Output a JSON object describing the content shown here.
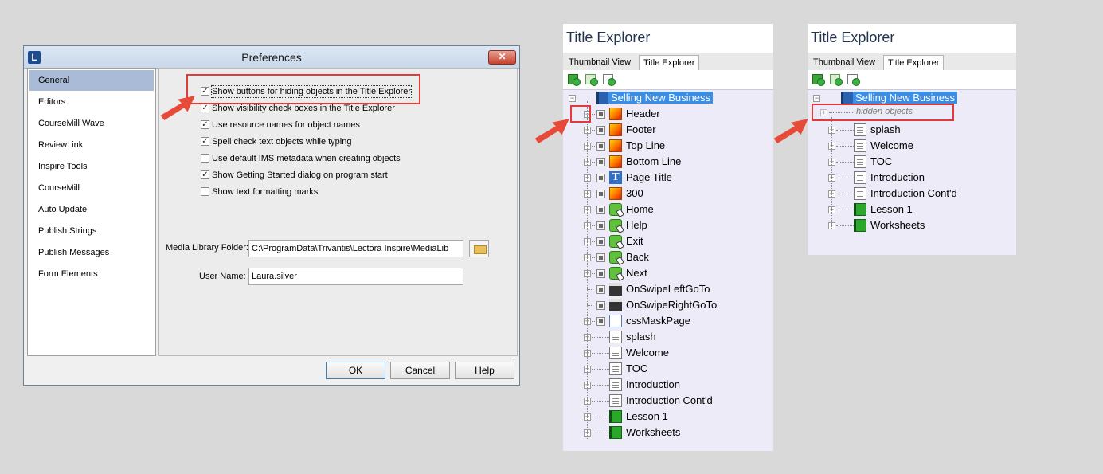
{
  "preferences": {
    "title": "Preferences",
    "app_icon": "L",
    "close_glyph": "✕",
    "sidebar": {
      "items": [
        "General",
        "Editors",
        "CourseMill Wave",
        "ReviewLink",
        "Inspire Tools",
        "CourseMill",
        "Auto Update",
        "Publish Strings",
        "Publish Messages",
        "Form Elements"
      ],
      "selected": "General"
    },
    "options": [
      {
        "label": "Show buttons for hiding objects in the Title Explorer",
        "checked": true
      },
      {
        "label": "Show visibility check boxes in the Title Explorer",
        "checked": true
      },
      {
        "label": "Use resource names for object names",
        "checked": true
      },
      {
        "label": "Spell check text objects while typing",
        "checked": true
      },
      {
        "label": "Use default IMS metadata when creating objects",
        "checked": false
      },
      {
        "label": "Show Getting Started dialog on program start",
        "checked": true
      },
      {
        "label": "Show text formatting marks",
        "checked": false
      }
    ],
    "media_library_label": "Media Library Folder:",
    "media_library_value": "C:\\ProgramData\\Trivantis\\Lectora Inspire\\MediaLib",
    "user_name_label": "User Name:",
    "user_name_value": "Laura.silver",
    "buttons": {
      "ok": "OK",
      "cancel": "Cancel",
      "help": "Help"
    }
  },
  "explorer_left": {
    "title": "Title Explorer",
    "tabs": [
      "Thumbnail View",
      "Title Explorer"
    ],
    "active_tab": "Title Explorer",
    "toolbar_icons": [
      "add-chapter-icon",
      "add-section-icon",
      "add-page-icon"
    ],
    "root": "Selling New Business",
    "items": [
      {
        "label": "Header",
        "icon": "image-icon"
      },
      {
        "label": "Footer",
        "icon": "image-icon"
      },
      {
        "label": "Top Line",
        "icon": "image-icon"
      },
      {
        "label": "Bottom Line",
        "icon": "image-icon"
      },
      {
        "label": "Page Title",
        "icon": "text-icon"
      },
      {
        "label": "300",
        "icon": "image-icon"
      },
      {
        "label": "Home",
        "icon": "button-icon"
      },
      {
        "label": "Help",
        "icon": "button-icon"
      },
      {
        "label": "Exit",
        "icon": "button-icon"
      },
      {
        "label": "Back",
        "icon": "button-icon"
      },
      {
        "label": "Next",
        "icon": "button-icon"
      },
      {
        "label": "OnSwipeLeftGoTo",
        "icon": "action-icon"
      },
      {
        "label": "OnSwipeRightGoTo",
        "icon": "action-icon"
      },
      {
        "label": "cssMaskPage",
        "icon": "css-page-icon"
      },
      {
        "label": "splash",
        "icon": "page-icon"
      },
      {
        "label": "Welcome",
        "icon": "page-icon"
      },
      {
        "label": "TOC",
        "icon": "page-icon"
      },
      {
        "label": "Introduction",
        "icon": "page-icon"
      },
      {
        "label": "Introduction Cont'd",
        "icon": "page-icon"
      },
      {
        "label": "Lesson 1",
        "icon": "chapter-icon"
      },
      {
        "label": "Worksheets",
        "icon": "chapter-icon"
      }
    ]
  },
  "explorer_right": {
    "title": "Title Explorer",
    "tabs": [
      "Thumbnail View",
      "Title Explorer"
    ],
    "active_tab": "Title Explorer",
    "toolbar_icons": [
      "add-chapter-icon",
      "add-section-icon",
      "add-page-icon"
    ],
    "root": "Selling New Business",
    "hidden_label": "hidden objects",
    "items": [
      {
        "label": "splash",
        "icon": "page-icon"
      },
      {
        "label": "Welcome",
        "icon": "page-icon"
      },
      {
        "label": "TOC",
        "icon": "page-icon"
      },
      {
        "label": "Introduction",
        "icon": "page-icon"
      },
      {
        "label": "Introduction Cont'd",
        "icon": "page-icon"
      },
      {
        "label": "Lesson 1",
        "icon": "chapter-icon"
      },
      {
        "label": "Worksheets",
        "icon": "chapter-icon"
      }
    ]
  },
  "colors": {
    "highlight": "#e03a3a",
    "selection": "#3a8ee6"
  }
}
